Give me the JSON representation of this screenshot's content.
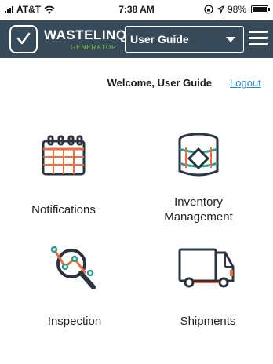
{
  "status_bar": {
    "carrier": "AT&T",
    "time": "7:38 AM",
    "battery": "98%",
    "battery_level": 0.98,
    "icons": [
      "signal-icon",
      "wifi-icon",
      "lock-rotation-icon",
      "location-icon",
      "battery-icon"
    ]
  },
  "header": {
    "brand_name": "WASTELINQ",
    "brand_tagline": "GENERATOR",
    "user_select_value": "User Guide",
    "colors": {
      "header_bg": "#374a5a",
      "brand_green": "#7cc242"
    }
  },
  "welcome": {
    "text": "Welcome, User Guide",
    "logout_label": "Logout"
  },
  "tiles": [
    {
      "label": "Notifications",
      "icon": "calendar-icon"
    },
    {
      "label": "Inventory\nManagement",
      "icon": "inventory-drum-icon"
    },
    {
      "label": "Inspection",
      "icon": "magnifier-chart-icon"
    },
    {
      "label": "Shipments",
      "icon": "truck-icon"
    }
  ],
  "accent_colors": {
    "orange": "#f26b3a",
    "teal": "#2e9c8c",
    "dark": "#2b3540"
  }
}
